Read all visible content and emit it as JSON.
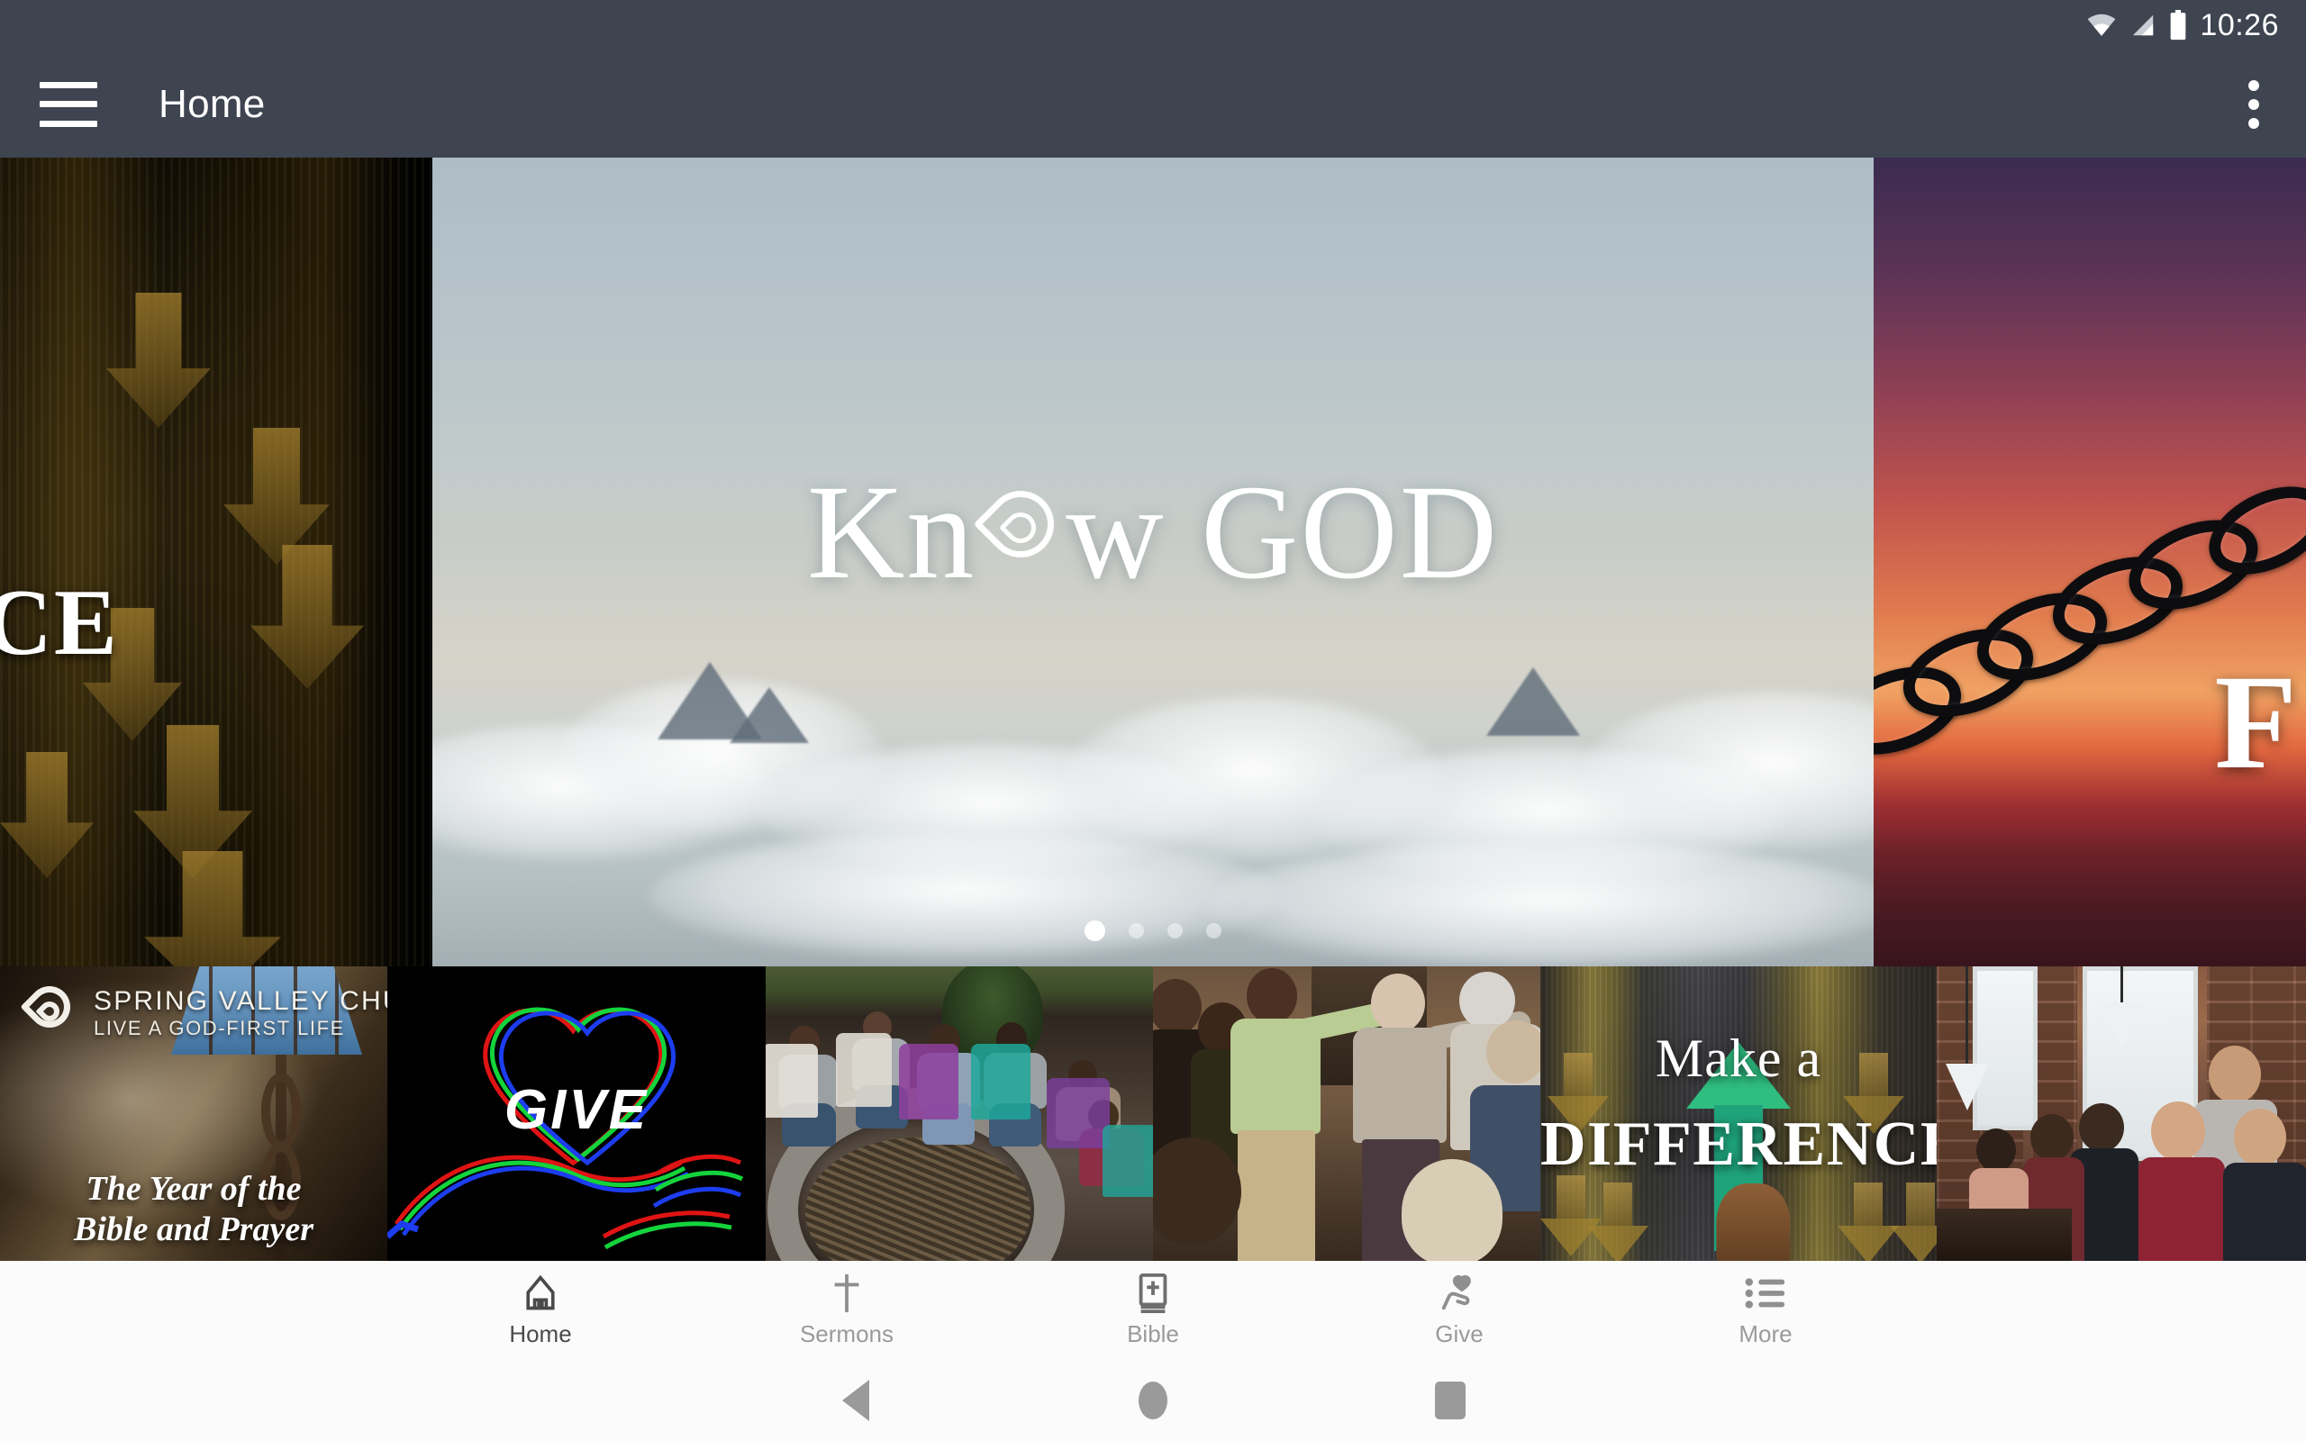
{
  "status_bar": {
    "time": "10:26",
    "icons": [
      "wifi-icon",
      "cellular-signal-icon",
      "battery-icon"
    ]
  },
  "app_bar": {
    "menu_icon": "hamburger-menu-icon",
    "title": "Home",
    "overflow_icon": "more-vert-icon"
  },
  "hero_carousel": {
    "active_index": 0,
    "dot_count": 4,
    "slides": [
      {
        "id": "know-god",
        "title": "Know GOD",
        "word_1": "Kn",
        "word_2": "w GOD",
        "drop_icon": "water-drop-icon",
        "scene": "clouds-mountains-sky"
      },
      {
        "id": "freedom",
        "title": "F",
        "scene": "sunset-ocean-broken-chain"
      },
      {
        "id": "difference",
        "title": "CE",
        "scene": "grunge-board-down-arrows"
      }
    ],
    "left_peek_text": "CE",
    "right_peek_text": "F"
  },
  "tiles": [
    {
      "id": "year-of-bible-prayer",
      "logo_icon": "spring-valley-drop-logo",
      "brand": "SPRING VALLEY CHURCH",
      "tagline": "LIVE A GOD-FIRST LIFE",
      "headline_line_1": "The Year of the",
      "headline_line_2": "Bible and Prayer"
    },
    {
      "id": "give",
      "headline": "GIVE",
      "art": "neon-hand-heart-rgb"
    },
    {
      "id": "small-groups",
      "headline": "",
      "art": "firepit-group-photo"
    },
    {
      "id": "prayer",
      "headline": "",
      "art": "prayer-circle-photo"
    },
    {
      "id": "make-a-difference",
      "headline_line_1": "Make a",
      "headline_line_2": "DIFFERENCE",
      "art": "green-up-arrow-asphalt"
    },
    {
      "id": "community-meal",
      "headline": "",
      "art": "potluck-group-photo"
    }
  ],
  "bottom_nav": {
    "active": "Home",
    "items": [
      {
        "label": "Home",
        "icon": "home-church-icon",
        "active": true
      },
      {
        "label": "Sermons",
        "icon": "cross-icon",
        "active": false
      },
      {
        "label": "Bible",
        "icon": "bible-book-icon",
        "active": false
      },
      {
        "label": "Give",
        "icon": "hand-heart-icon",
        "active": false
      },
      {
        "label": "More",
        "icon": "list-menu-icon",
        "active": false
      }
    ]
  },
  "system_nav": {
    "back_icon": "android-back-icon",
    "home_icon": "android-home-icon",
    "recents_icon": "android-recents-icon"
  },
  "colors": {
    "appbar": "#3e4450",
    "nav_bg": "#fbfbfb",
    "nav_inactive": "#9a9a9a",
    "nav_active": "#4a4a4a",
    "accent_green": "#2fbd80"
  }
}
